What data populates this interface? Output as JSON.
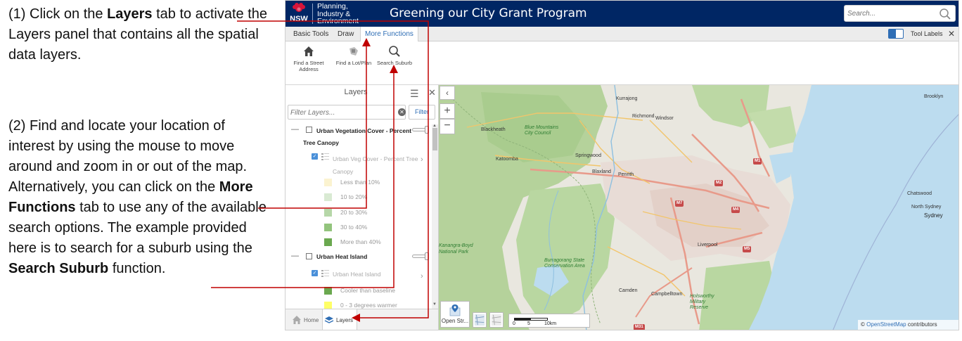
{
  "instructions": {
    "step1": {
      "prefix": "(1) Click on the ",
      "bold": "Layers",
      "suffix": " tab to activate the Layers panel that contains all the spatial data layers."
    },
    "step2": {
      "part1": "(2) Find and locate your location of interest by using the mouse to move around and zoom in or out of the map. Alternatively, you can click on the ",
      "bold1": "More Functions",
      "part2": " tab to use any of the available search options. The example provided here is to search for a suburb using the ",
      "bold2": "Search Suburb",
      "part3": " function."
    }
  },
  "header": {
    "logo_text": "NSW",
    "dept_lines": [
      "Planning,",
      "Industry &",
      "Environment"
    ],
    "title": "Greening our City Grant Program",
    "search_placeholder": "Search..."
  },
  "tabs": {
    "items": [
      "Basic Tools",
      "Draw",
      "More Functions"
    ],
    "active": "More Functions",
    "tool_labels": "Tool Labels",
    "close_glyph": "✕"
  },
  "toolbar": {
    "tools": [
      {
        "label": "Find a Street Address",
        "icon": "home-icon"
      },
      {
        "label": "Find a Lot/Plan",
        "icon": "lot-icon"
      },
      {
        "label": "Search Suburb",
        "icon": "search-icon"
      }
    ]
  },
  "layers_panel": {
    "title": "Layers",
    "filter_placeholder": "Filter Layers...",
    "filter_button": "Filter",
    "close_glyph": "✕",
    "menu_glyph": "☰",
    "groups": [
      {
        "name_line1": "Urban Vegetation Cover - Percent",
        "name_line2": "Tree Canopy",
        "sub_layer": "Urban Veg Cover - Percent Tree Canopy",
        "legend": [
          {
            "label": "Less than 10%",
            "color": "#fbf3d0"
          },
          {
            "label": "10 to 20%",
            "color": "#d9ead3"
          },
          {
            "label": "20 to 30%",
            "color": "#b6d7a8"
          },
          {
            "label": "30 to 40%",
            "color": "#93c47d"
          },
          {
            "label": "More than 40%",
            "color": "#6aa84f"
          }
        ]
      },
      {
        "name_line1": "Urban Heat Island",
        "sub_layer": "Urban Heat Island",
        "legend": [
          {
            "label": "Cooler than baseline",
            "color": "#6aa84f"
          },
          {
            "label": "0 - 3 degrees warmer",
            "color": "#ffff66"
          }
        ]
      }
    ]
  },
  "bottombar": {
    "home": "Home",
    "layers": "Layers"
  },
  "map": {
    "basemap_label": "Open Str...",
    "scale": {
      "s0": "0",
      "s5": "5",
      "s10": "10km"
    },
    "attribution_copy": "©",
    "attribution_osm": "OpenStreetMap",
    "attribution_rest": "contributors",
    "labels": {
      "kurrajong": "Kurrajong",
      "richmond": "Richmond",
      "windsor": "Windsor",
      "blackheath": "Blackheath",
      "katoomba": "Katoomba",
      "springwood": "Springwood",
      "blaxland": "Blaxland",
      "penrith": "Penrith",
      "bluemtns": "Blue Mountains City Council",
      "brooklyn": "Brooklyn",
      "chatswood": "Chatswood",
      "northsydney": "North Sydney",
      "sydney": "Sydney",
      "liverpool": "Liverpool",
      "camden": "Camden",
      "campbelltown": "Campbelltown",
      "kanangra": "Kanangra-Boyd National Park",
      "burragorang": "Burragorang State Conservation Area",
      "holsworthy": "Holsworthy Military Reserve"
    },
    "shields": [
      "M1",
      "M2",
      "M4",
      "M5",
      "M7",
      "M31"
    ]
  }
}
